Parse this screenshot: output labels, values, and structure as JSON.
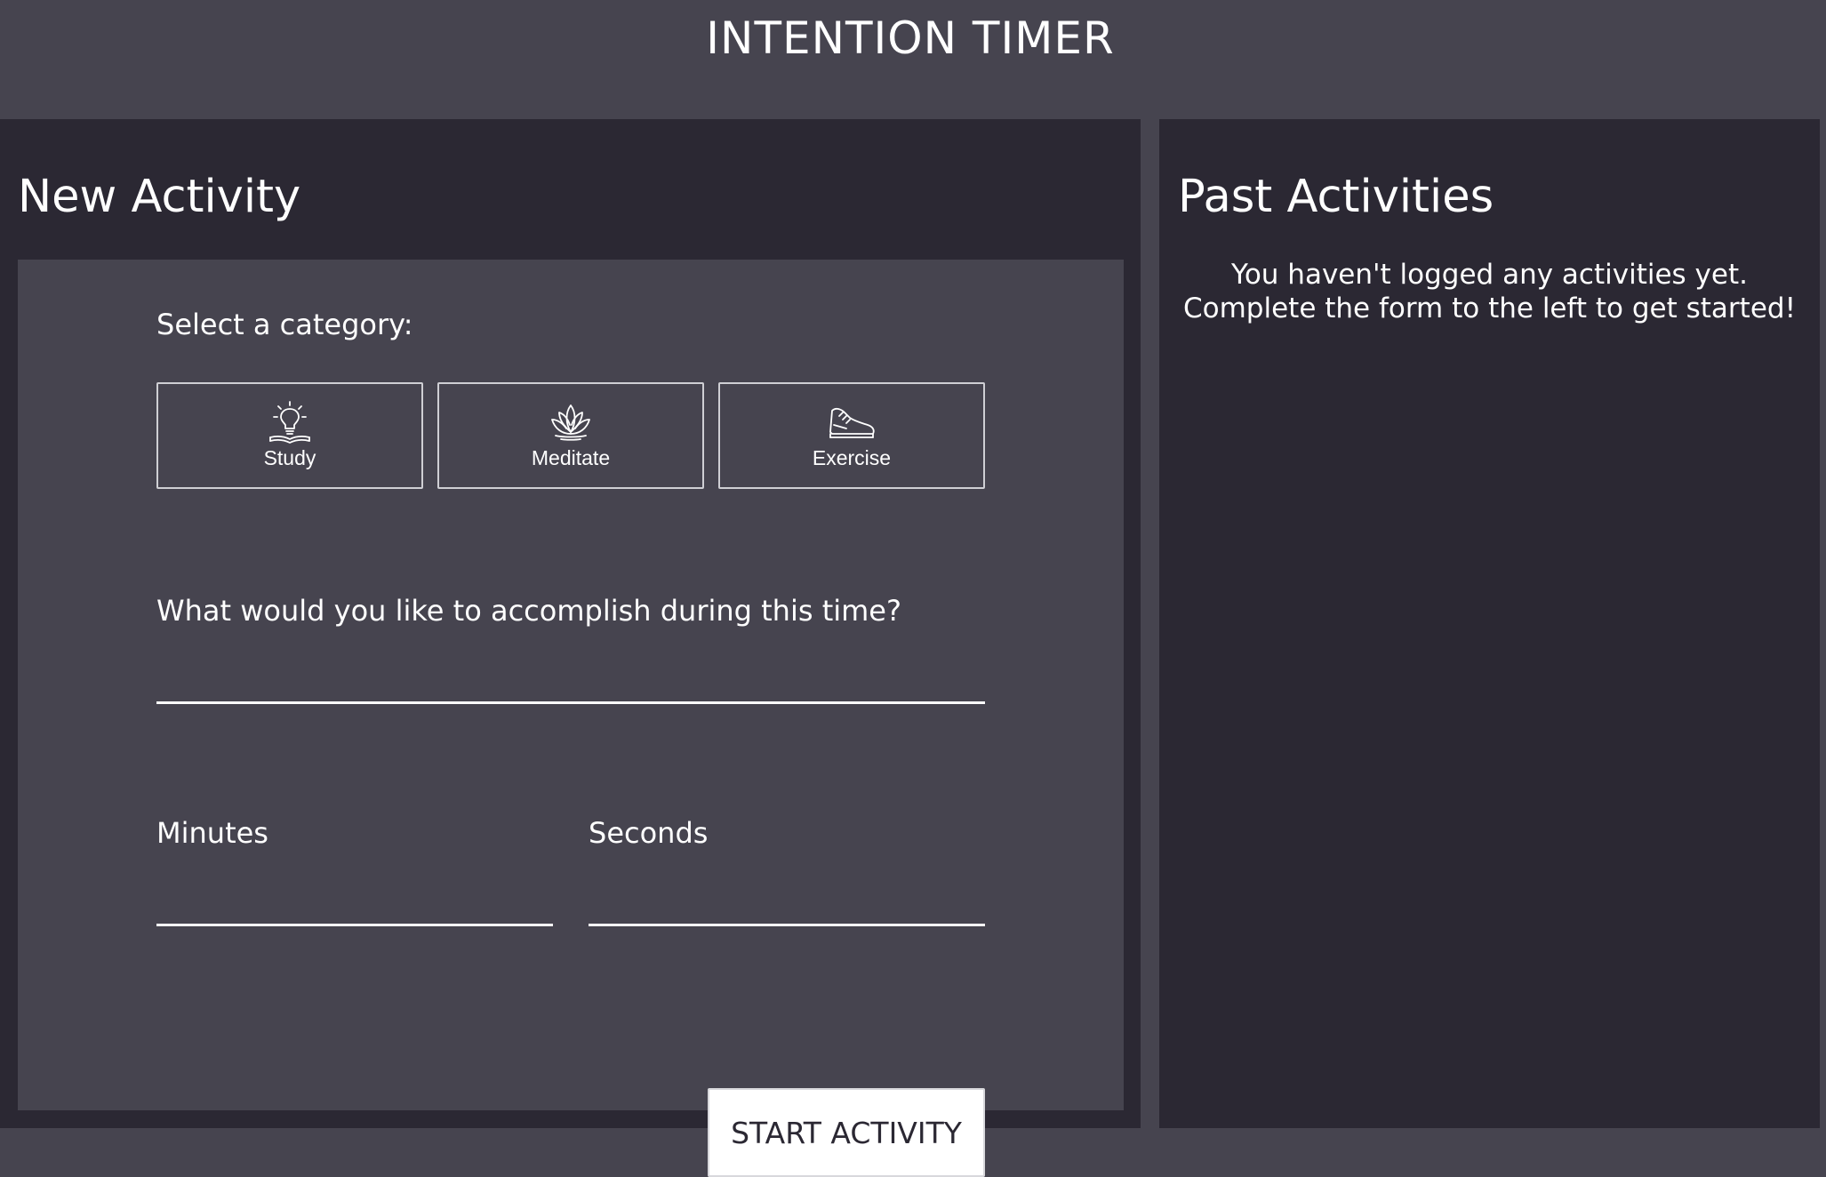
{
  "header": {
    "title": "INTENTION TIMER"
  },
  "new_activity": {
    "heading": "New Activity",
    "category_prompt": "Select a category:",
    "categories": [
      {
        "label": "Study",
        "icon": "lightbulb-book-icon"
      },
      {
        "label": "Meditate",
        "icon": "lotus-icon"
      },
      {
        "label": "Exercise",
        "icon": "sneaker-icon"
      }
    ],
    "description_prompt": "What would you like to accomplish during this time?",
    "description_value": "",
    "minutes_label": "Minutes",
    "minutes_value": "",
    "seconds_label": "Seconds",
    "seconds_value": "",
    "start_button_label": "START ACTIVITY"
  },
  "past_activities": {
    "heading": "Past Activities",
    "empty_line_1": "You haven't logged any activities yet.",
    "empty_line_2": "Complete the form to the left to get started!"
  },
  "colors": {
    "header_bg": "#46444f",
    "panel_bg": "#2b2833",
    "card_bg": "#46444f",
    "text": "#ffffff",
    "button_bg": "#ffffff",
    "button_text": "#2b2833"
  }
}
